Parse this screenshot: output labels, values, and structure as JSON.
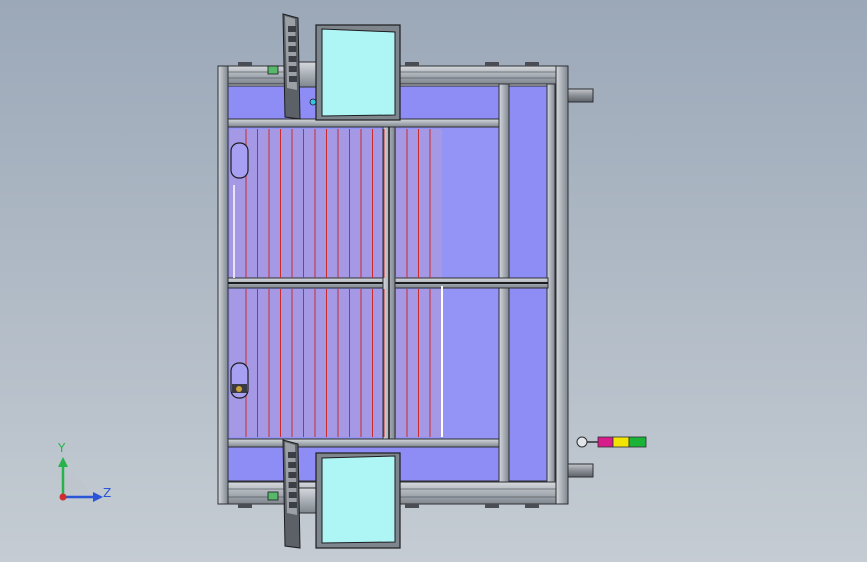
{
  "viewport": {
    "background_top": "#9ba8b8",
    "background_bottom": "#c5ccd3"
  },
  "colors": {
    "frame_metal": "#a9afb6",
    "frame_edge": "#2d2f33",
    "panel_fill": "#8d8df5",
    "panel_fill_light": "#9999f8",
    "panel_tint": "#b39ad6",
    "light_curtain": "#cc2b2b",
    "screen_glass": "#aef5f5",
    "monitor_frame": "#7f858c",
    "cylinder": "#8a8f96",
    "tower_magenta": "#d81b8a",
    "tower_yellow": "#f2e600",
    "tower_green": "#1bb336"
  },
  "icons": {
    "triad": "coordinate-triad-icon",
    "stack_light": "signal-tower-icon"
  },
  "triad": {
    "y_label": "Y",
    "z_label": "Z",
    "y_color": "#27b24a",
    "z_color": "#2a55d6",
    "origin_color": "#d12b2b"
  }
}
